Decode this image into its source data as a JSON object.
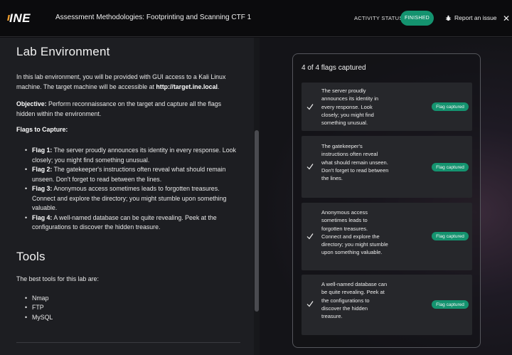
{
  "header": {
    "logo_text": "INE",
    "title": "Assessment Methodologies: Footprinting and Scanning CTF 1",
    "activity_label": "ACTIVITY STATUS:",
    "status": "FINISHED",
    "report_label": "Report an issue",
    "close_icon": "close-icon",
    "report_icon": "bug-icon",
    "colors": {
      "status": "#14936f",
      "logo_accent": "#f0a030"
    }
  },
  "lab": {
    "heading": "Lab Environment",
    "intro": "In this lab environment, you will be provided with GUI access to a Kali Linux machine. The target machine will be accessible at ",
    "target_url": "http://target.ine.local",
    "intro_end": ".",
    "objective_label": "Objective:",
    "objective_text": " Perform reconnaissance on the target and capture all the flags hidden within the environment.",
    "flags_heading": "Flags to Capture:",
    "flags": [
      {
        "label": "Flag 1:",
        "text": " The server proudly announces its identity in every response. Look closely; you might find something unusual."
      },
      {
        "label": "Flag 2:",
        "text": " The gatekeeper's instructions often reveal what should remain unseen. Don't forget to read between the lines."
      },
      {
        "label": "Flag 3:",
        "text": " Anonymous access sometimes leads to forgotten treasures. Connect and explore the directory; you might stumble upon something valuable."
      },
      {
        "label": "Flag 4:",
        "text": " A well-named database can be quite revealing. Peek at the configurations to discover the hidden treasure."
      }
    ]
  },
  "tools": {
    "heading": "Tools",
    "intro": "The best tools for this lab are:",
    "items": [
      "Nmap",
      "FTP",
      "MySQL"
    ]
  },
  "progress": {
    "count_label": "4 of 4 flags captured",
    "items": [
      {
        "text": "The server proudly announces its identity in every response. Look closely; you might find something unusual.",
        "badge": "Flag captured",
        "icon": "check-icon"
      },
      {
        "text": "The gatekeeper's instructions often reveal what should remain unseen. Don't forget to read between the lines.",
        "badge": "Flag captured",
        "icon": "check-icon"
      },
      {
        "text": "Anonymous access sometimes leads to forgotten treasures. Connect and explore the directory; you might stumble upon something valuable.",
        "badge": "Flag captured",
        "icon": "check-icon"
      },
      {
        "text": "A well-named database can be quite revealing. Peek at the configurations to discover the hidden treasure.",
        "badge": "Flag captured",
        "icon": "check-icon"
      }
    ]
  }
}
